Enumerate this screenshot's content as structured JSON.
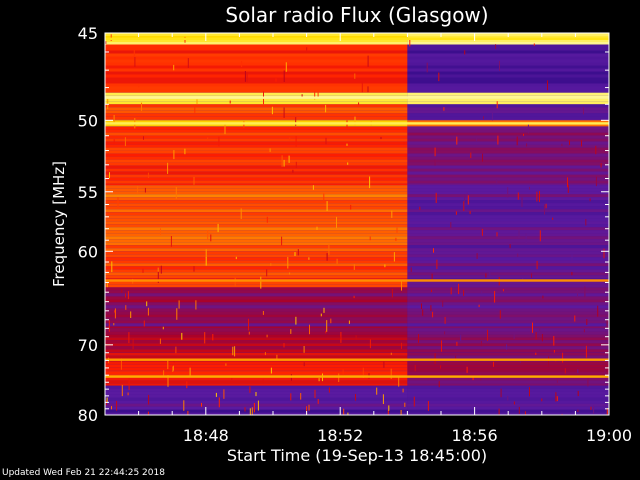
{
  "chart_data": {
    "type": "heatmap",
    "title": "Solar radio Flux (Glasgow)",
    "xlabel": "Start Time (19-Sep-13 18:45:00)",
    "ylabel": "Frequency [MHz]",
    "x_ticks": [
      "18:48",
      "18:52",
      "18:56",
      "19:00"
    ],
    "x_tick_minutes": [
      3,
      7,
      11,
      15
    ],
    "xlim_minutes": [
      0,
      15
    ],
    "y_ticks": [
      45,
      50,
      55,
      60,
      70,
      80
    ],
    "ylim_mhz": [
      45,
      80
    ],
    "y_scale": "reciprocal",
    "colormap": [
      "#1a0078",
      "#5a1aa0",
      "#b00020",
      "#ff1e00",
      "#ff7a00",
      "#ffe000",
      "#ffffd0"
    ],
    "background_change_time": "18:54",
    "bands": [
      {
        "f1": 45.0,
        "f2": 45.6,
        "before": 0.85,
        "after": 0.9
      },
      {
        "f1": 45.6,
        "f2": 48.3,
        "before": 0.5,
        "after": 0.12
      },
      {
        "f1": 48.3,
        "f2": 49.0,
        "before": 0.9,
        "after": 0.93
      },
      {
        "f1": 49.0,
        "f2": 50.0,
        "before": 0.55,
        "after": 0.15
      },
      {
        "f1": 50.0,
        "f2": 50.4,
        "before": 0.85,
        "after": 0.68
      },
      {
        "f1": 50.4,
        "f2": 54.5,
        "before": 0.52,
        "after": 0.22
      },
      {
        "f1": 54.5,
        "f2": 60.0,
        "before": 0.62,
        "after": 0.18
      },
      {
        "f1": 60.0,
        "f2": 63.5,
        "before": 0.55,
        "after": 0.18
      },
      {
        "f1": 63.5,
        "f2": 68.0,
        "before": 0.25,
        "after": 0.2
      },
      {
        "f1": 68.0,
        "f2": 71.0,
        "before": 0.33,
        "after": 0.24
      },
      {
        "f1": 71.0,
        "f2": 73.5,
        "before": 0.45,
        "after": 0.27
      },
      {
        "f1": 73.5,
        "f2": 75.5,
        "before": 0.5,
        "after": 0.26
      },
      {
        "f1": 75.5,
        "f2": 80.0,
        "before": 0.14,
        "after": 0.14
      }
    ],
    "lines": [
      {
        "f": 45.3,
        "level": 0.85
      },
      {
        "f": 48.6,
        "level": 0.95
      },
      {
        "f": 50.2,
        "level": 0.9
      },
      {
        "f": 62.8,
        "level": 0.7
      },
      {
        "f": 71.9,
        "level": 0.72
      },
      {
        "f": 74.2,
        "level": 0.75
      }
    ]
  },
  "footer": {
    "updated": "Updated Wed Feb 21 22:44:25 2018"
  }
}
